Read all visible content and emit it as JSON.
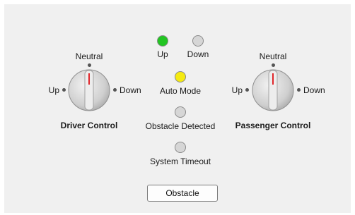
{
  "driver": {
    "title": "Driver Control",
    "label_up": "Up",
    "label_neutral": "Neutral",
    "label_down": "Down",
    "value": "Neutral"
  },
  "passenger": {
    "title": "Passenger Control",
    "label_up": "Up",
    "label_neutral": "Neutral",
    "label_down": "Down",
    "value": "Neutral"
  },
  "lamps": {
    "up": {
      "label": "Up",
      "color": "#22c522"
    },
    "down": {
      "label": "Down",
      "color": "#d6d6d6"
    },
    "auto_mode": {
      "label": "Auto Mode",
      "color": "#f5ea10"
    },
    "obstacle_detected": {
      "label": "Obstacle Detected",
      "color": "#d6d6d6"
    },
    "system_timeout": {
      "label": "System Timeout",
      "color": "#d6d6d6"
    }
  },
  "obstacle_button": {
    "label": "Obstacle"
  },
  "colors": {
    "panel_bg": "#f0f0f0",
    "knob_indicator": "#e0262a"
  }
}
